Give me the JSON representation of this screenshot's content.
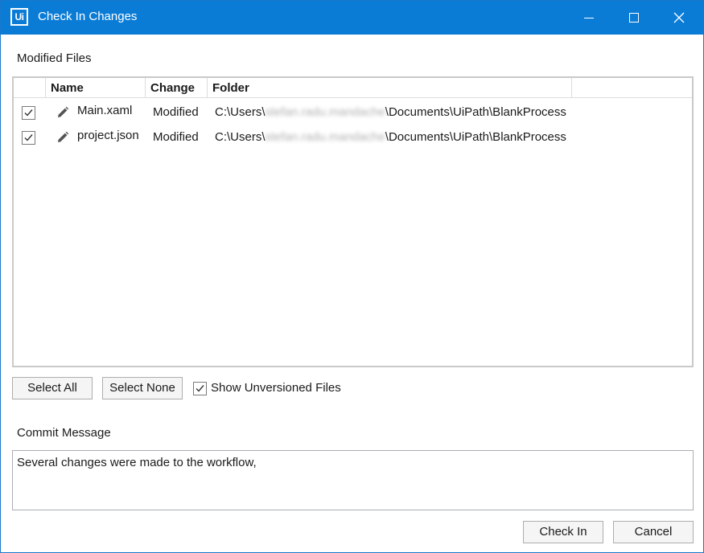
{
  "window": {
    "title": "Check In Changes",
    "app_icon_text": "Ui",
    "accent_color": "#0a7cd6"
  },
  "labels": {
    "modified_files": "Modified Files",
    "commit_message": "Commit Message"
  },
  "grid": {
    "columns": [
      "Name",
      "Change",
      "Folder"
    ],
    "rows": [
      {
        "checked": true,
        "icon": "pencil-icon",
        "name": "Main.xaml",
        "change": "Modified",
        "folder_prefix": "C:\\Users\\",
        "folder_redacted": "stefan.radu.mandache",
        "folder_suffix": "\\Documents\\UiPath\\BlankProcess"
      },
      {
        "checked": true,
        "icon": "pencil-icon",
        "name": "project.json",
        "change": "Modified",
        "folder_prefix": "C:\\Users\\",
        "folder_redacted": "stefan.radu.mandache",
        "folder_suffix": "\\Documents\\UiPath\\BlankProcess"
      }
    ]
  },
  "actions": {
    "select_all": "Select All",
    "select_none": "Select None",
    "show_unversioned": "Show Unversioned Files",
    "show_unversioned_checked": true
  },
  "commit": {
    "message": "Several changes were made to the workflow,"
  },
  "footer": {
    "check_in": "Check In",
    "cancel": "Cancel"
  }
}
